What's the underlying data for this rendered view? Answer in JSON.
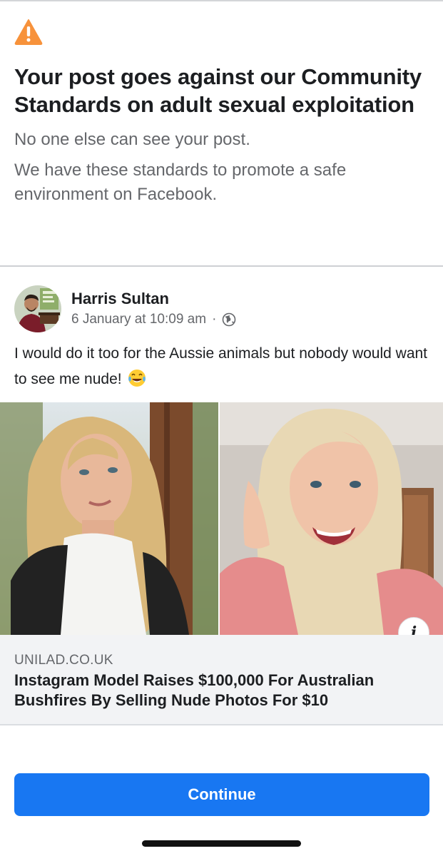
{
  "notice": {
    "icon": "warning-triangle-icon",
    "icon_color": "#f7923b",
    "headline": "Your post goes against our Community Standards on adult sexual exploitation",
    "visibility_text": "No one else can see your post.",
    "reason_text": "We have these standards to promote a safe environment on Facebook."
  },
  "post": {
    "author": "Harris Sultan",
    "timestamp": "6 January at 10:09 am",
    "separator": "·",
    "privacy_icon": "globe-icon",
    "body_text": "I would do it too for the Aussie animals but nobody would want to see me nude!",
    "emoji": "tears-of-joy-emoji-icon",
    "link": {
      "domain": "UNILAD.CO.UK",
      "title": "Instagram Model Raises $100,000 For Australian Bushfires By Selling Nude Photos For $10",
      "info_icon": "i"
    }
  },
  "actions": {
    "continue_label": "Continue",
    "accent_color": "#1877f2"
  }
}
